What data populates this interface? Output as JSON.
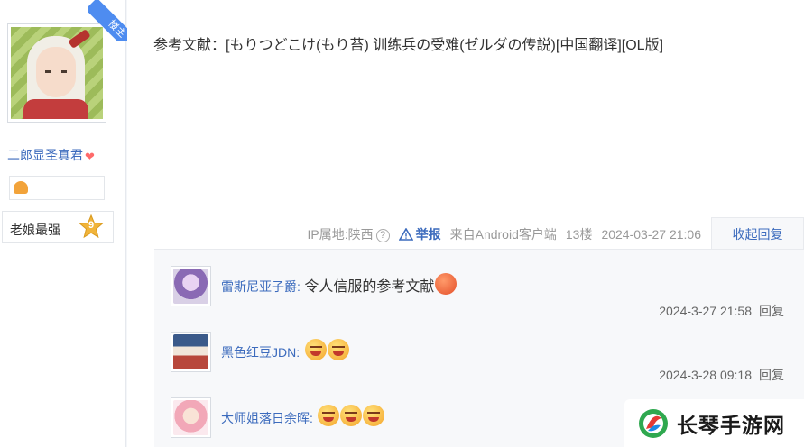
{
  "user": {
    "owner_badge": "楼主",
    "name": "二郎显圣真君",
    "level_name": "老娘最强",
    "level": "9"
  },
  "post": {
    "text": "参考文献：[もりつどこけ(もり苔) 训练兵の受难(ゼルダの传説)[中国翻译][OL版]",
    "ip_location": "IP属地:陕西",
    "report_label": "举报",
    "source": "来自Android客户端",
    "floor": "13楼",
    "time": "2024-03-27 21:06",
    "collapse_label": "收起回复"
  },
  "replies": [
    {
      "name": "雷斯尼亚子爵",
      "separator": ":",
      "content": "令人信服的参考文献",
      "emojis": [
        "orange-face"
      ],
      "time": "2024-3-27 21:58",
      "reply_label": "回复"
    },
    {
      "name": "黑色红豆JDN",
      "separator": ":",
      "content": "",
      "emojis": [
        "angry-face",
        "angry-face"
      ],
      "time": "2024-3-28 09:18",
      "reply_label": "回复"
    },
    {
      "name": "大师姐落日余晖",
      "separator": ":",
      "content": "",
      "emojis": [
        "angry-face",
        "angry-face",
        "angry-face"
      ]
    }
  ],
  "watermark": {
    "text": "长琴手游网"
  },
  "colors": {
    "link": "#3c6bbd",
    "badge": "#4e8cf0",
    "reply_bg": "#f7f8fa"
  }
}
